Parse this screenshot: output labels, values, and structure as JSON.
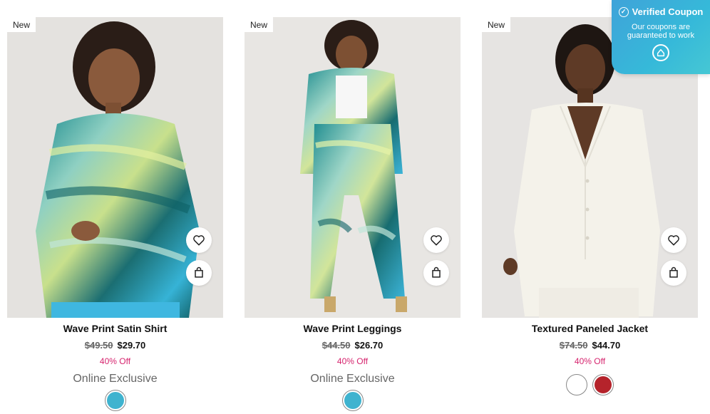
{
  "products": [
    {
      "badge": "New",
      "name": "Wave Print Satin Shirt",
      "price_old": "$49.50",
      "price_new": "$29.70",
      "discount": "40% Off",
      "exclusive": "Online Exclusive",
      "swatches": [
        "#3fb3cf"
      ]
    },
    {
      "badge": "New",
      "name": "Wave Print Leggings",
      "price_old": "$44.50",
      "price_new": "$26.70",
      "discount": "40% Off",
      "exclusive": "Online Exclusive",
      "swatches": [
        "#3fb3cf"
      ]
    },
    {
      "badge": "New",
      "name": "Textured Paneled Jacket",
      "price_old": "$74.50",
      "price_new": "$44.70",
      "discount": "40% Off",
      "swatches": [
        "#ffffff",
        "#b5232b"
      ]
    }
  ],
  "coupon": {
    "title": "Verified Coupon",
    "subtitle": "Our coupons are guaranteed to work"
  },
  "icons": {
    "wishlist": "heart-icon",
    "bag": "shopping-bag-icon",
    "check": "check-circle-icon",
    "logo": "coupon-logo-icon"
  },
  "colors": {
    "discount": "#d6246e",
    "coupon_bg": "#36b9d9"
  }
}
